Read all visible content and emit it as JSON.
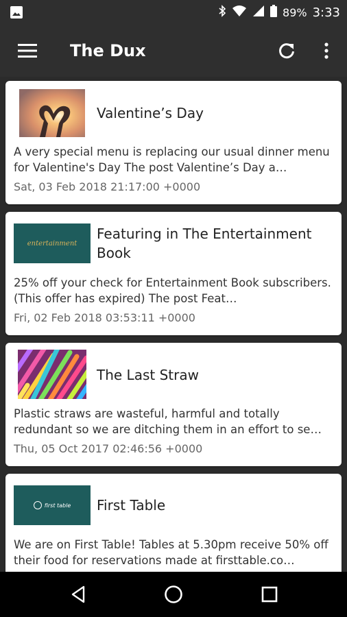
{
  "status_bar": {
    "battery_percent": "89%",
    "time": "3:33",
    "icons": [
      "image-icon",
      "bluetooth-icon",
      "wifi-icon",
      "signal-icon",
      "battery-icon"
    ]
  },
  "app_bar": {
    "title": "The Dux",
    "icons": [
      "menu-icon",
      "refresh-icon",
      "more-vert-icon"
    ]
  },
  "feed": {
    "items": [
      {
        "title": "Valentine’s Day",
        "description": "A very special menu is replacing our usual dinner menu for Valentine's Day  The post Valentine’s Day a…",
        "date": "Sat, 03 Feb 2018 21:17:00 +0000",
        "thumbnail": "hands-heart-sunset"
      },
      {
        "title": "Featuring in The Entertainment Book",
        "description": "25% off your check for Entertainment Book subscribers. (This offer has expired)  The post Feat…",
        "date": "Fri, 02 Feb 2018 03:53:11 +0000",
        "thumbnail": "entertainment-logo",
        "thumbnail_text": "entertainment"
      },
      {
        "title": "The Last Straw",
        "description": "Plastic straws are wasteful, harmful and totally redundant so we are ditching them in an effort to se…",
        "date": "Thu, 05 Oct 2017 02:46:56 +0000",
        "thumbnail": "colorful-straws"
      },
      {
        "title": "First Table",
        "description": "We are on First Table! Tables at 5.30pm receive 50% off their food for reservations made at firsttable.co…",
        "date": "",
        "thumbnail": "first-table-logo",
        "thumbnail_text": "first table"
      }
    ]
  },
  "nav_bar": {
    "icons": [
      "back-icon",
      "home-icon",
      "recents-icon"
    ]
  },
  "colors": {
    "app_bar": "#2f2f2f",
    "background": "#2b2b2b",
    "card": "#ffffff",
    "teal_thumb": "#1e5c5c",
    "nav_bar": "#000000"
  }
}
